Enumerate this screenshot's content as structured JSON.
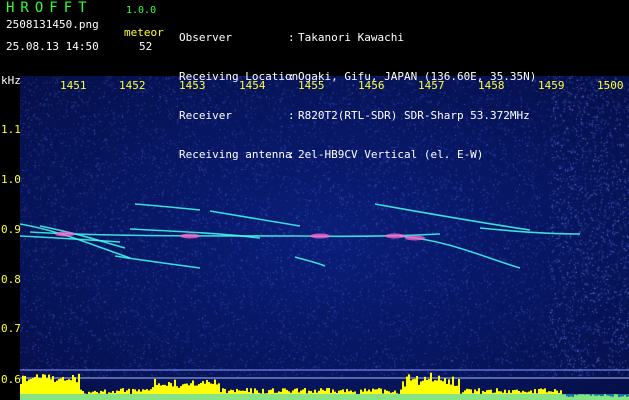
{
  "header": {
    "brand": "HROFFT",
    "version": "1.0.0",
    "filename": "2508131450.png",
    "timestamp": "25.08.13 14:50",
    "meteor_label": "meteor",
    "meteor_count": "52",
    "info": [
      {
        "label": "Observer",
        "value": "Takanori Kawachi"
      },
      {
        "label": "Receiving Location",
        "value": "Ogaki, Gifu, JAPAN (136.60E, 35.35N)"
      },
      {
        "label": "Receiver",
        "value": "R820T2(RTL-SDR) SDR-Sharp 53.372MHz"
      },
      {
        "label": "Receiving antenna",
        "value": "2el-HB9CV Vertical (el. E-W)"
      }
    ]
  },
  "axes": {
    "y_unit": "kHz",
    "x_ticks": [
      "1451",
      "1452",
      "1453",
      "1454",
      "1455",
      "1456",
      "1457",
      "1458",
      "1459",
      "1500"
    ],
    "y_ticks": [
      "1.1",
      "1.0",
      "0.9",
      "0.8",
      "0.7",
      "0.6"
    ]
  },
  "colors": {
    "label_green": "#33ff33",
    "tick_yellow": "#ffff33",
    "background_blue": "#071660",
    "trace_cyan": "#44ffee",
    "signal_yellow": "#ffff00"
  }
}
